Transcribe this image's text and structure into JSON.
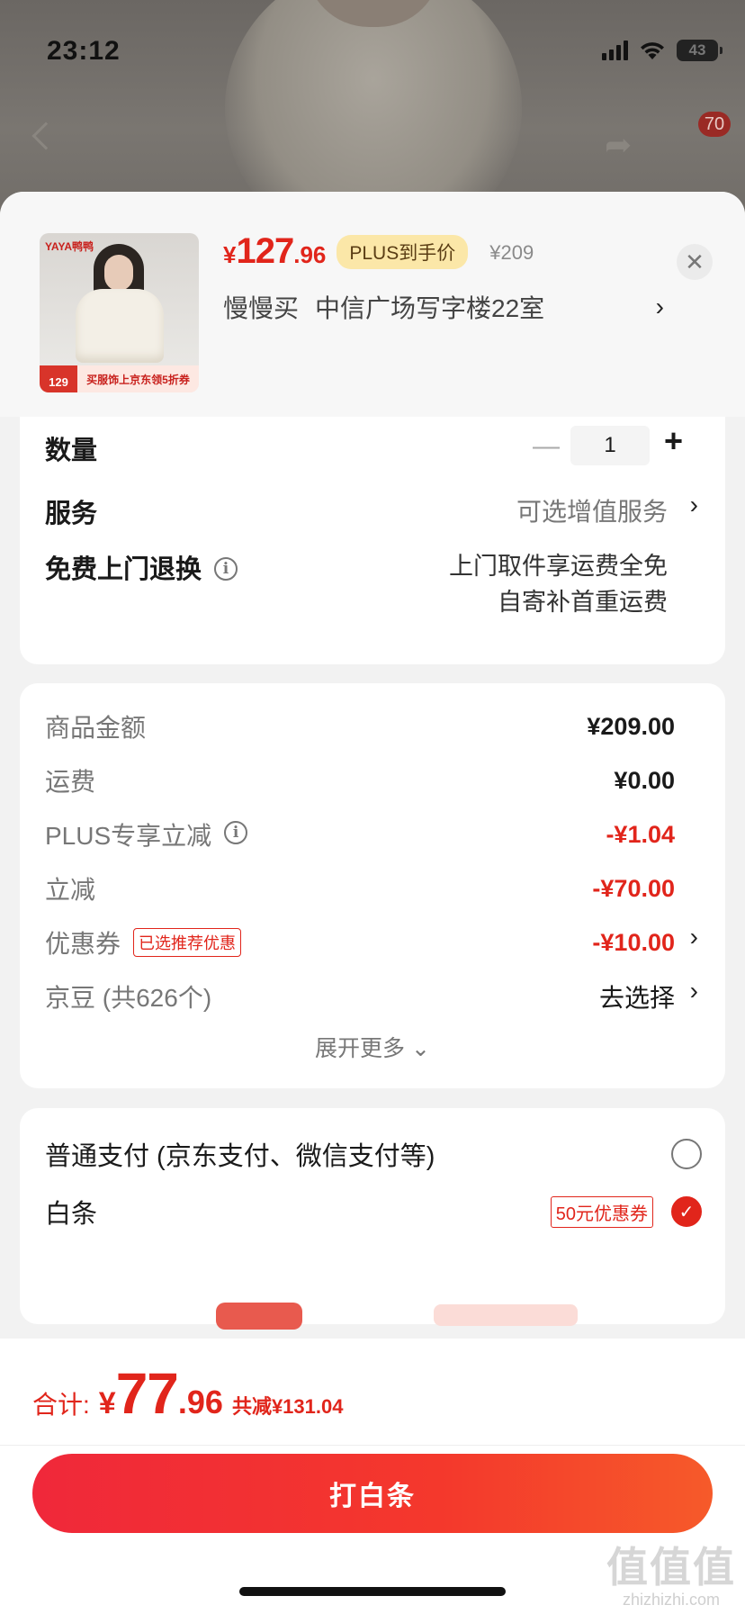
{
  "status_bar": {
    "time": "23:12",
    "battery": "43"
  },
  "cart_badge": "70",
  "product": {
    "thumb_brand": "YAYA鸭鸭",
    "thumb_promo_price": "129",
    "thumb_promo_text": "买服饰上京东领5折券",
    "price_yen": "¥",
    "price_int": "127",
    "price_dec": ".96",
    "plus_tag": "PLUS到手价",
    "original_price": "¥209",
    "address_user": "慢慢买",
    "address": "中信广场写字楼22室"
  },
  "options": {
    "quantity_label": "数量",
    "quantity_value": "1",
    "service_label": "服务",
    "service_value": "可选增值服务",
    "return_label": "免费上门退换",
    "return_note_1": "上门取件享运费全免",
    "return_note_2": "自寄补首重运费"
  },
  "fees": {
    "items": [
      {
        "label": "商品金额",
        "value": "¥209.00"
      },
      {
        "label": "运费",
        "value": "¥0.00"
      },
      {
        "label": "PLUS专享立减",
        "value": "-¥1.04"
      },
      {
        "label": "立减",
        "value": "-¥70.00"
      },
      {
        "label": "优惠券",
        "value": "-¥10.00",
        "tag": "已选推荐优惠"
      },
      {
        "label": "京豆 (共626个)",
        "value": "去选择"
      }
    ],
    "expand_label": "展开更多",
    "negative_color": "#e1251b"
  },
  "payment": {
    "normal_label": "普通支付 (京东支付、微信支付等)",
    "baitiao_label": "白条",
    "baitiao_coupon": "50元优惠券"
  },
  "footer": {
    "total_label": "合计:",
    "total_yen": "¥",
    "total_int": "77",
    "total_dec": ".96",
    "total_saving": "共减¥131.04",
    "pay_button": "打白条",
    "watermark": "值值值",
    "watermark_url": "zhizhizhi.com"
  },
  "colors": {
    "accent": "#e1251b",
    "plus_tag_bg": "#fbe7a8"
  }
}
